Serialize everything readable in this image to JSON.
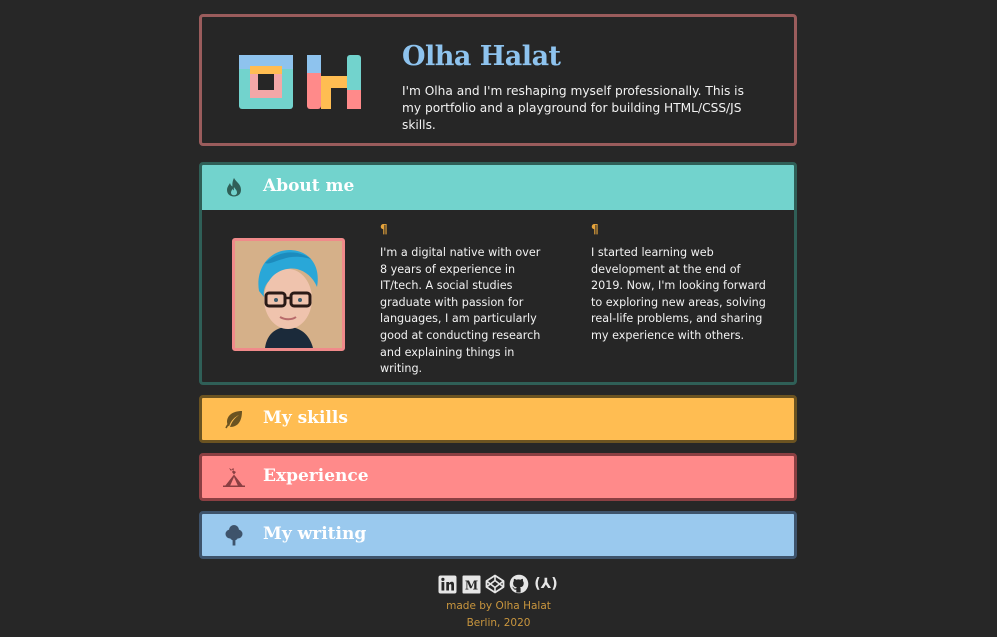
{
  "header": {
    "title": "Olha Halat",
    "description": "I'm Olha and I'm reshaping myself professionally. This is my portfolio and a playground for building HTML/CSS/JS skills."
  },
  "about": {
    "title": "About me",
    "icon": "fire-icon",
    "pilcrow": "¶",
    "col1": "I'm a digital native with over 8 years of experience in IT/tech. A social studies graduate with passion for languages, I am particularly good at conducting research and explaining things in writing.",
    "col2": "I started learning web development at the end of 2019. Now, I'm looking forward to exploring new areas, solving real-life problems, and sharing my experience with others."
  },
  "skills": {
    "title": "My skills",
    "icon": "leaf-icon"
  },
  "experience": {
    "title": "Experience",
    "icon": "tent-icon"
  },
  "writing": {
    "title": "My writing",
    "icon": "tree-icon"
  },
  "footer": {
    "icons": [
      "linkedin-icon",
      "medium-icon",
      "codepen-icon",
      "github-icon",
      "freecodecamp-icon"
    ],
    "fcc_glyph": "(⅄)",
    "made_by": "made by Olha Halat",
    "location": "Berlin, 2020"
  },
  "colors": {
    "background": "#272727",
    "title_blue": "#8ec3ee",
    "about_teal": "#72d3cd",
    "skills_orange": "#ffbd52",
    "experience_pink": "#ff8a8a",
    "writing_blue": "#9ac9ee",
    "footer_gold": "#c9963e"
  }
}
